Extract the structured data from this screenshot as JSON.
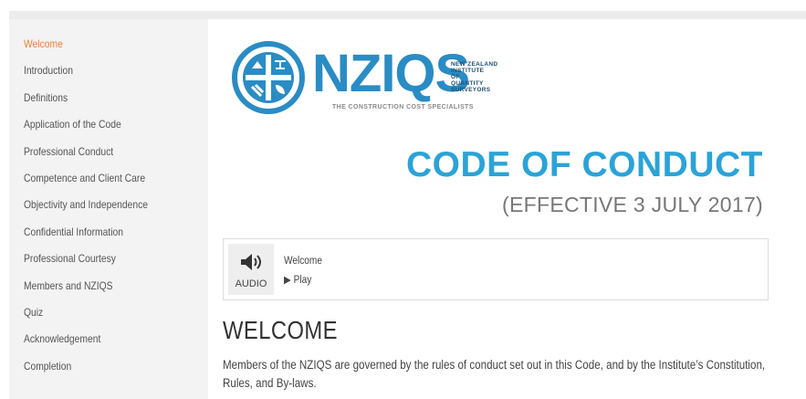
{
  "sidebar": {
    "items": [
      {
        "label": "Welcome",
        "active": true
      },
      {
        "label": "Introduction",
        "active": false
      },
      {
        "label": "Definitions",
        "active": false
      },
      {
        "label": "Application of the Code",
        "active": false
      },
      {
        "label": "Professional Conduct",
        "active": false
      },
      {
        "label": "Competence and Client Care",
        "active": false
      },
      {
        "label": "Objectivity and Independence",
        "active": false
      },
      {
        "label": "Confidential Information",
        "active": false
      },
      {
        "label": "Professional Courtesy",
        "active": false
      },
      {
        "label": "Members and NZIQS",
        "active": false
      },
      {
        "label": "Quiz",
        "active": false
      },
      {
        "label": "Acknowledgement",
        "active": false
      },
      {
        "label": "Completion",
        "active": false
      }
    ]
  },
  "logo": {
    "text": "NZIQS",
    "side_lines": [
      "NEW ZEALAND",
      "INSTITUTE",
      "OF",
      "QUANTITY",
      "SURVEYORS"
    ],
    "tagline": "THE CONSTRUCTION COST SPECIALISTS"
  },
  "header": {
    "title": "CODE OF CONDUCT",
    "subtitle": "(EFFECTIVE 3 JULY 2017)"
  },
  "audio": {
    "icon": "speaker-icon",
    "label": "AUDIO",
    "track_title": "Welcome",
    "play_label": "▶ Play"
  },
  "content": {
    "heading": "WELCOME",
    "body": "Members of the NZIQS are governed by the rules of conduct set out in this Code, and by the Institute’s Constitution, Rules, and By-laws."
  },
  "colors": {
    "accent": "#ef7f3a",
    "brand_blue": "#2a8cc4",
    "title_blue": "#2ba3d6",
    "sidebar_bg": "#f3f3f3"
  }
}
